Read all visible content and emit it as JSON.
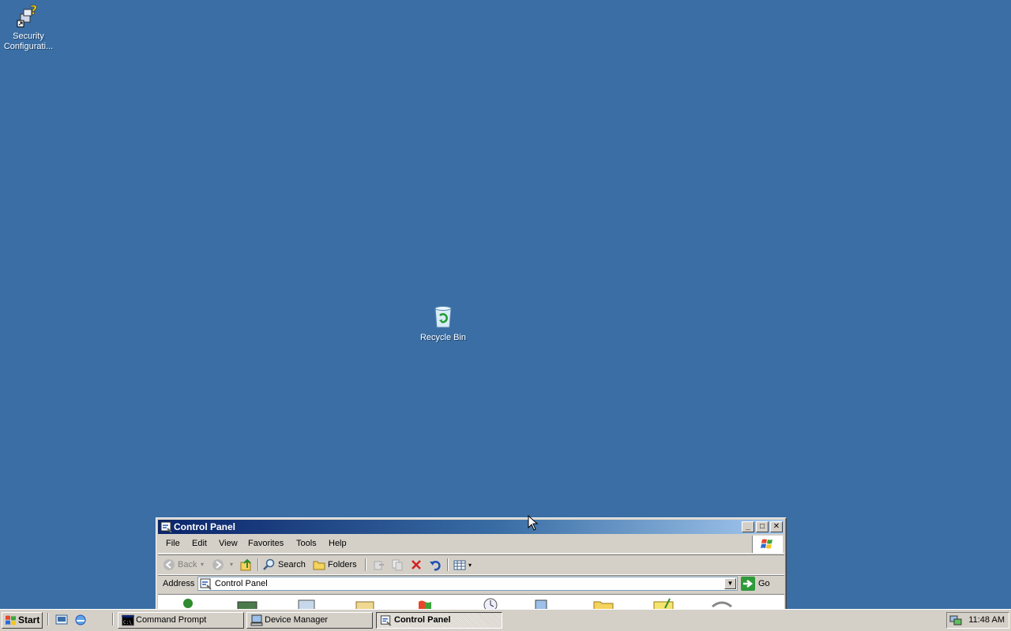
{
  "desktop": {
    "background_color": "#3a6ea5",
    "icons": [
      {
        "label": "Security Configurati...",
        "icon": "security-config-icon"
      },
      {
        "label": "Recycle Bin",
        "icon": "recycle-bin-icon"
      }
    ]
  },
  "window": {
    "title": "Control Panel",
    "title_icon": "control-panel-icon",
    "controls": {
      "minimize": "_",
      "maximize": "□",
      "close": "✕"
    },
    "menu": [
      "File",
      "Edit",
      "View",
      "Favorites",
      "Tools",
      "Help"
    ],
    "toolbar": {
      "back": "Back",
      "search": "Search",
      "folders": "Folders"
    },
    "address": {
      "label": "Address",
      "value": "Control Panel",
      "go": "Go"
    }
  },
  "taskbar": {
    "start": "Start",
    "tasks": [
      {
        "label": "Command Prompt",
        "active": false
      },
      {
        "label": "Device Manager",
        "active": false
      },
      {
        "label": "Control Panel",
        "active": true
      }
    ],
    "clock": "11:48 AM"
  }
}
